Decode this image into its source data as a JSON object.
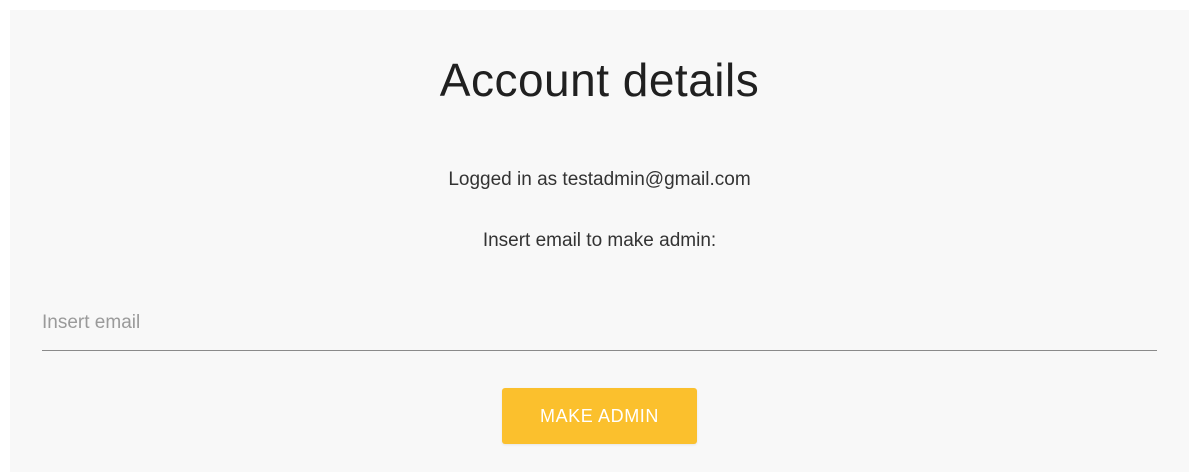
{
  "account": {
    "title": "Account details",
    "logged_in_text": "Logged in as testadmin@gmail.com",
    "instruction": "Insert email to make admin:"
  },
  "email_input": {
    "placeholder": "Insert email",
    "value": ""
  },
  "actions": {
    "make_admin_label": "MAKE ADMIN"
  },
  "colors": {
    "background": "#f8f8f8",
    "button": "#fbc02d",
    "button_text": "#ffffff",
    "text": "#333333"
  }
}
